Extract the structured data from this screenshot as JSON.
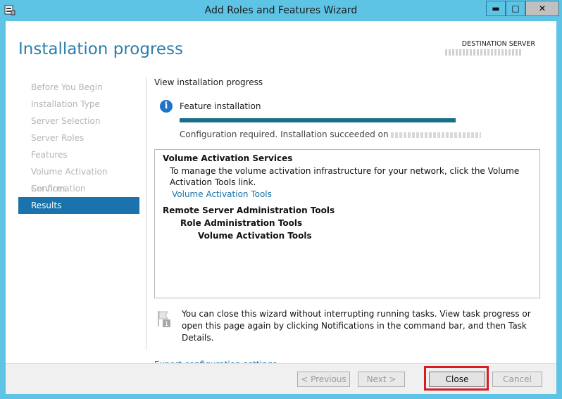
{
  "window": {
    "title": "Add Roles and Features Wizard",
    "controls": {
      "minimize": "▬",
      "maximize": "□",
      "close": "✕"
    }
  },
  "header": {
    "page_title": "Installation progress",
    "destination_label": "DESTINATION SERVER"
  },
  "nav": {
    "items": [
      {
        "label": "Before You Begin"
      },
      {
        "label": "Installation Type"
      },
      {
        "label": "Server Selection"
      },
      {
        "label": "Server Roles"
      },
      {
        "label": "Features"
      },
      {
        "label": "Volume Activation Services"
      },
      {
        "label": "Confirmation"
      },
      {
        "label": "Results"
      }
    ],
    "active_index": 7
  },
  "main": {
    "view_label": "View installation progress",
    "feature_label": "Feature installation",
    "progress_fraction": 1.0,
    "status_text": "Configuration required. Installation succeeded on",
    "results": {
      "role1_title": "Volume Activation Services",
      "role1_desc": "To manage the volume activation infrastructure for your network, click the Volume Activation Tools link.",
      "role1_link": "Volume Activation Tools",
      "tool_title": "Remote Server Administration Tools",
      "tool_sub": "Role Administration Tools",
      "tool_sub2": "Volume Activation Tools"
    },
    "note": "You can close this wizard without interrupting running tasks. View task progress or open this page again by clicking Notifications in the command bar, and then Task Details.",
    "notification_count": "1",
    "export_link": "Export configuration settings"
  },
  "footer": {
    "previous": "< Previous",
    "next": "Next >",
    "close": "Close",
    "cancel": "Cancel"
  },
  "colors": {
    "accent": "#1a73ad",
    "titlebar": "#5ec4e6",
    "highlight": "#d91c22"
  }
}
